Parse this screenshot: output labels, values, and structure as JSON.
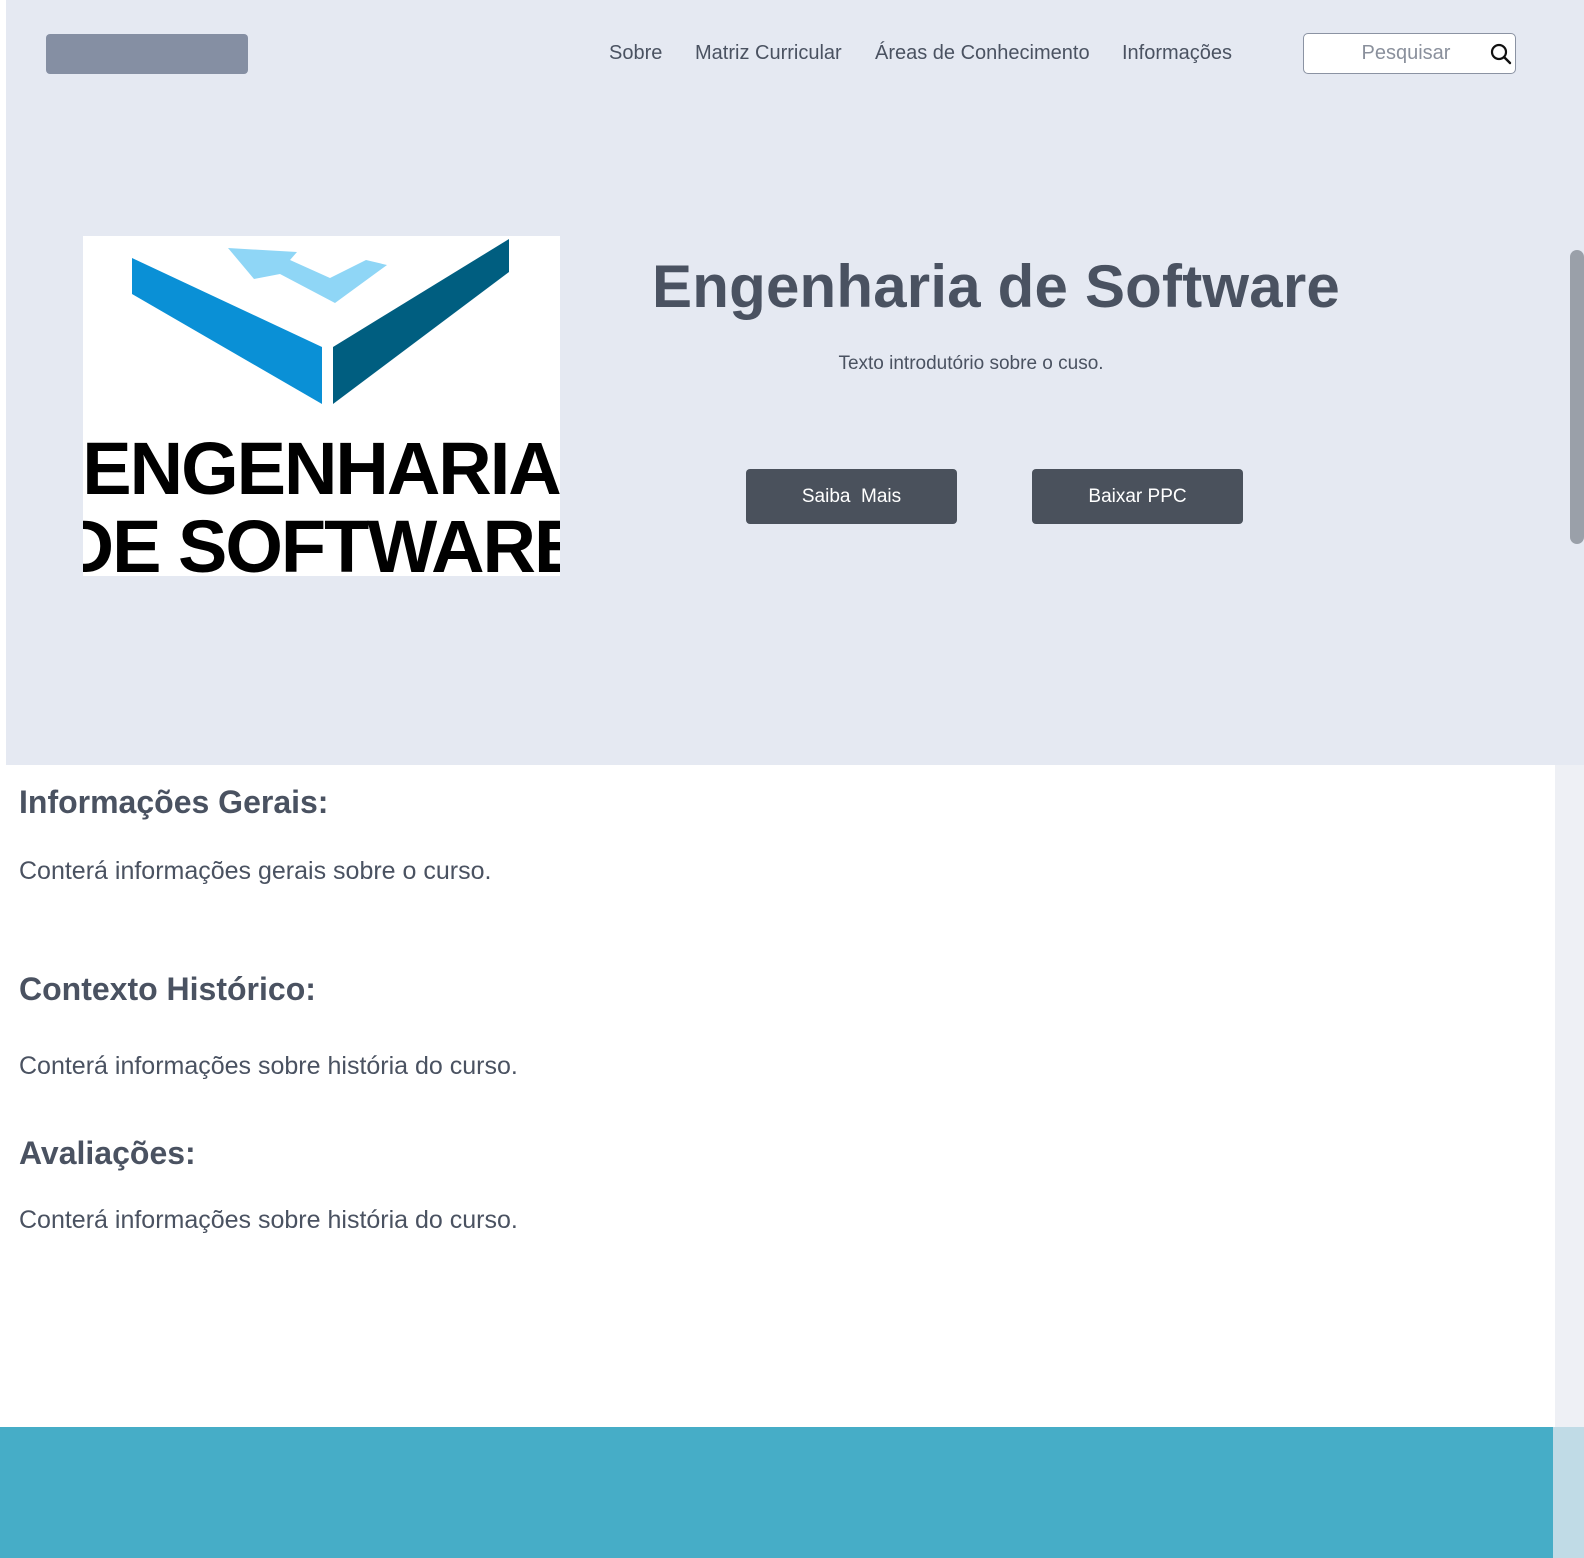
{
  "nav": {
    "links": [
      "Sobre",
      "Matriz Curricular",
      "Áreas de Conhecimento",
      "Informações"
    ],
    "search_placeholder": "Pesquisar"
  },
  "hero": {
    "title": "Engenharia de Software",
    "subtitle": "Texto introdutório sobre o cuso.",
    "primary_button": "Saiba  Mais",
    "secondary_button": "Baixar PPC",
    "logo_text": [
      "ENGENHARIA",
      "DE SOFTWARE"
    ]
  },
  "sections": [
    {
      "heading": "Informações Gerais:",
      "text": "Conterá informações gerais sobre o curso."
    },
    {
      "heading": "Contexto Histórico:",
      "text": "Conterá informações sobre história do curso."
    },
    {
      "heading": "Avaliações:",
      "text": "Conterá informações sobre história do curso."
    }
  ],
  "colors": {
    "hero_bg": "#e5e9f2",
    "button_bg": "#4a515c",
    "text": "#4a5261",
    "footer_bg": "#46adc7",
    "logo_blue_light": "#8fd6f6",
    "logo_blue_mid": "#0a90d6",
    "logo_blue_dark": "#005e80"
  }
}
